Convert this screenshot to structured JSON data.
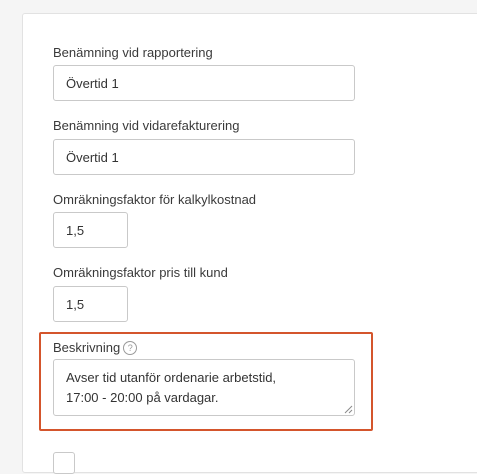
{
  "form": {
    "reporting_name": {
      "label": "Benämning vid rapportering",
      "value": "Övertid 1"
    },
    "reinvoicing_name": {
      "label": "Benämning vid vidarefakturering",
      "value": "Övertid 1"
    },
    "cost_factor": {
      "label": "Omräkningsfaktor för kalkylkostnad",
      "value": "1,5"
    },
    "price_factor": {
      "label": "Omräkningsfaktor pris till kund",
      "value": "1,5"
    },
    "description": {
      "label": "Beskrivning",
      "value": "Avser tid utanför ordenarie arbetstid,\n17:00 - 20:00 på vardagar."
    }
  },
  "icons": {
    "help": "question-circle-icon",
    "resize": "resize-grip-icon"
  },
  "colors": {
    "highlight_border": "#d4552c",
    "input_border": "#c9c9c9",
    "panel_background": "#ffffff",
    "page_background": "#f5f5f5"
  }
}
